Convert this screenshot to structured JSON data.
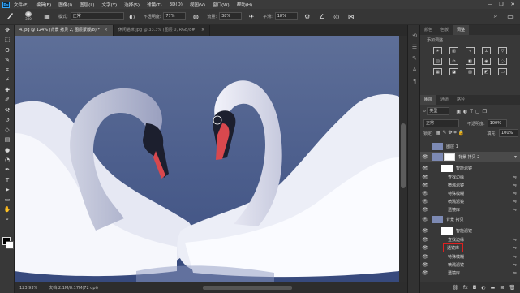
{
  "app": {
    "logo": "Ps"
  },
  "menu": [
    "文件(F)",
    "编辑(E)",
    "图像(I)",
    "图层(L)",
    "文字(Y)",
    "选择(S)",
    "滤镜(T)",
    "3D(D)",
    "视图(V)",
    "窗口(W)",
    "帮助(H)"
  ],
  "window_controls": [
    "—",
    "❐",
    "✕"
  ],
  "options": {
    "brush_size": "300",
    "mode_label": "模式:",
    "mode_value": "正常",
    "opacity_label": "不透明度:",
    "opacity_value": "77%",
    "flow_label": "流量:",
    "flow_value": "38%",
    "smooth_label": "平滑:",
    "smooth_value": "18%"
  },
  "tabs": [
    {
      "label": "4.jpg @ 124% (背景 拷贝 2, 图层蒙版/8) *"
    },
    {
      "label": "休闲猫咪.jpg @ 33.3% (图层 0, RGB/8#)"
    }
  ],
  "tools": [
    "move-icon",
    "marquee-icon",
    "lasso-icon",
    "quick-select-icon",
    "crop-icon",
    "eyedropper-icon",
    "healing-icon",
    "brush-icon",
    "stamp-icon",
    "history-brush-icon",
    "eraser-icon",
    "gradient-icon",
    "blur-icon",
    "dodge-icon",
    "pen-icon",
    "type-icon",
    "path-select-icon",
    "shape-icon",
    "hand-icon",
    "zoom-icon",
    "more-icon",
    "colors-icon"
  ],
  "status": {
    "zoom": "123.93%",
    "doc": "文档:2.1M/8.17M(72 dpi)"
  },
  "panel_tabs_top": [
    "颜色",
    "色板",
    "调整"
  ],
  "adjustments_title": "添加调整",
  "panel_tabs_layers": [
    "图层",
    "通道",
    "路径"
  ],
  "layers_panel": {
    "kind": "类型",
    "blend": "正常",
    "opacity_label": "不透明度:",
    "opacity_value": "100%",
    "lock_label": "锁定:",
    "fill_label": "填充:",
    "fill_value": "100%"
  },
  "layers": [
    {
      "name": "图层 1",
      "eye": "",
      "fx": ""
    },
    {
      "name": "背景 拷贝 2",
      "eye": "👁",
      "fx": ""
    },
    {
      "name": "智能滤镜",
      "eye": "👁",
      "fx": ""
    },
    {
      "name": "查找边缘",
      "eye": "👁",
      "fx": "⇋"
    },
    {
      "name": "喷溅滤镜",
      "eye": "👁",
      "fx": "⇋"
    },
    {
      "name": "特殊模糊",
      "eye": "👁",
      "fx": "⇋"
    },
    {
      "name": "喷溅滤镜",
      "eye": "👁",
      "fx": "⇋"
    },
    {
      "name": "透镜库",
      "eye": "👁",
      "fx": "⇋"
    },
    {
      "name": "背景 拷贝",
      "eye": "👁",
      "fx": ""
    },
    {
      "name": "智能滤镜",
      "eye": "👁",
      "fx": ""
    },
    {
      "name": "查找边缘",
      "eye": "👁",
      "fx": "⇋"
    },
    {
      "name": "透镜库",
      "eye": "👁",
      "fx": "⇋"
    },
    {
      "name": "特殊模糊",
      "eye": "👁",
      "fx": "⇋"
    },
    {
      "name": "喷溅滤镜",
      "eye": "👁",
      "fx": "⇋"
    },
    {
      "name": "透镜库",
      "eye": "👁",
      "fx": "⇋"
    }
  ],
  "colors": {
    "accent": "#31a8ff",
    "highlight": "#e02020",
    "selected_row": "#4a4a4a"
  }
}
